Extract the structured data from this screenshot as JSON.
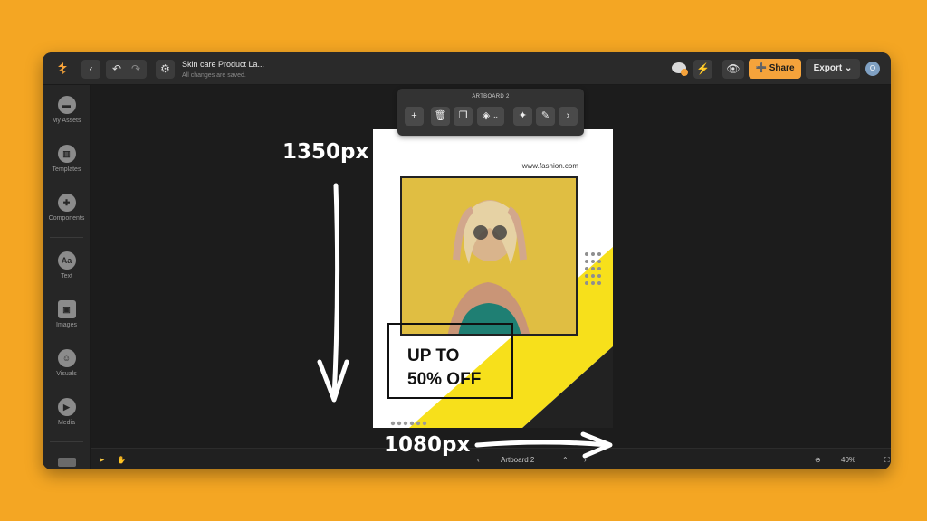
{
  "header": {
    "doc_title": "Skin care Product La...",
    "doc_status": "All changes are saved.",
    "share_label": "Share",
    "export_label": "Export",
    "avatar_initial": "O"
  },
  "sidebar": {
    "items": [
      {
        "label": "My Assets",
        "icon": "folder-icon"
      },
      {
        "label": "Templates",
        "icon": "templates-icon"
      },
      {
        "label": "Components",
        "icon": "puzzle-icon"
      },
      {
        "label": "Text",
        "icon": "text-icon",
        "glyph": "Aa"
      },
      {
        "label": "Images",
        "icon": "image-icon"
      },
      {
        "label": "Visuals",
        "icon": "visuals-icon"
      },
      {
        "label": "Media",
        "icon": "play-icon"
      }
    ]
  },
  "artboard_toolbar": {
    "title": "ARTBOARD 2"
  },
  "artboard": {
    "url": "www.fashion.com",
    "promo_line1": "UP TO",
    "promo_line2": "50% OFF"
  },
  "bottombar": {
    "artboard_name": "Artboard 2",
    "zoom": "40%"
  },
  "annotations": {
    "height_label": "1350px",
    "width_label": "1080px"
  },
  "colors": {
    "background": "#f4a623",
    "accent": "#f5a33b",
    "artboard_yellow": "#f7e01b",
    "artboard_dark": "#222222"
  }
}
